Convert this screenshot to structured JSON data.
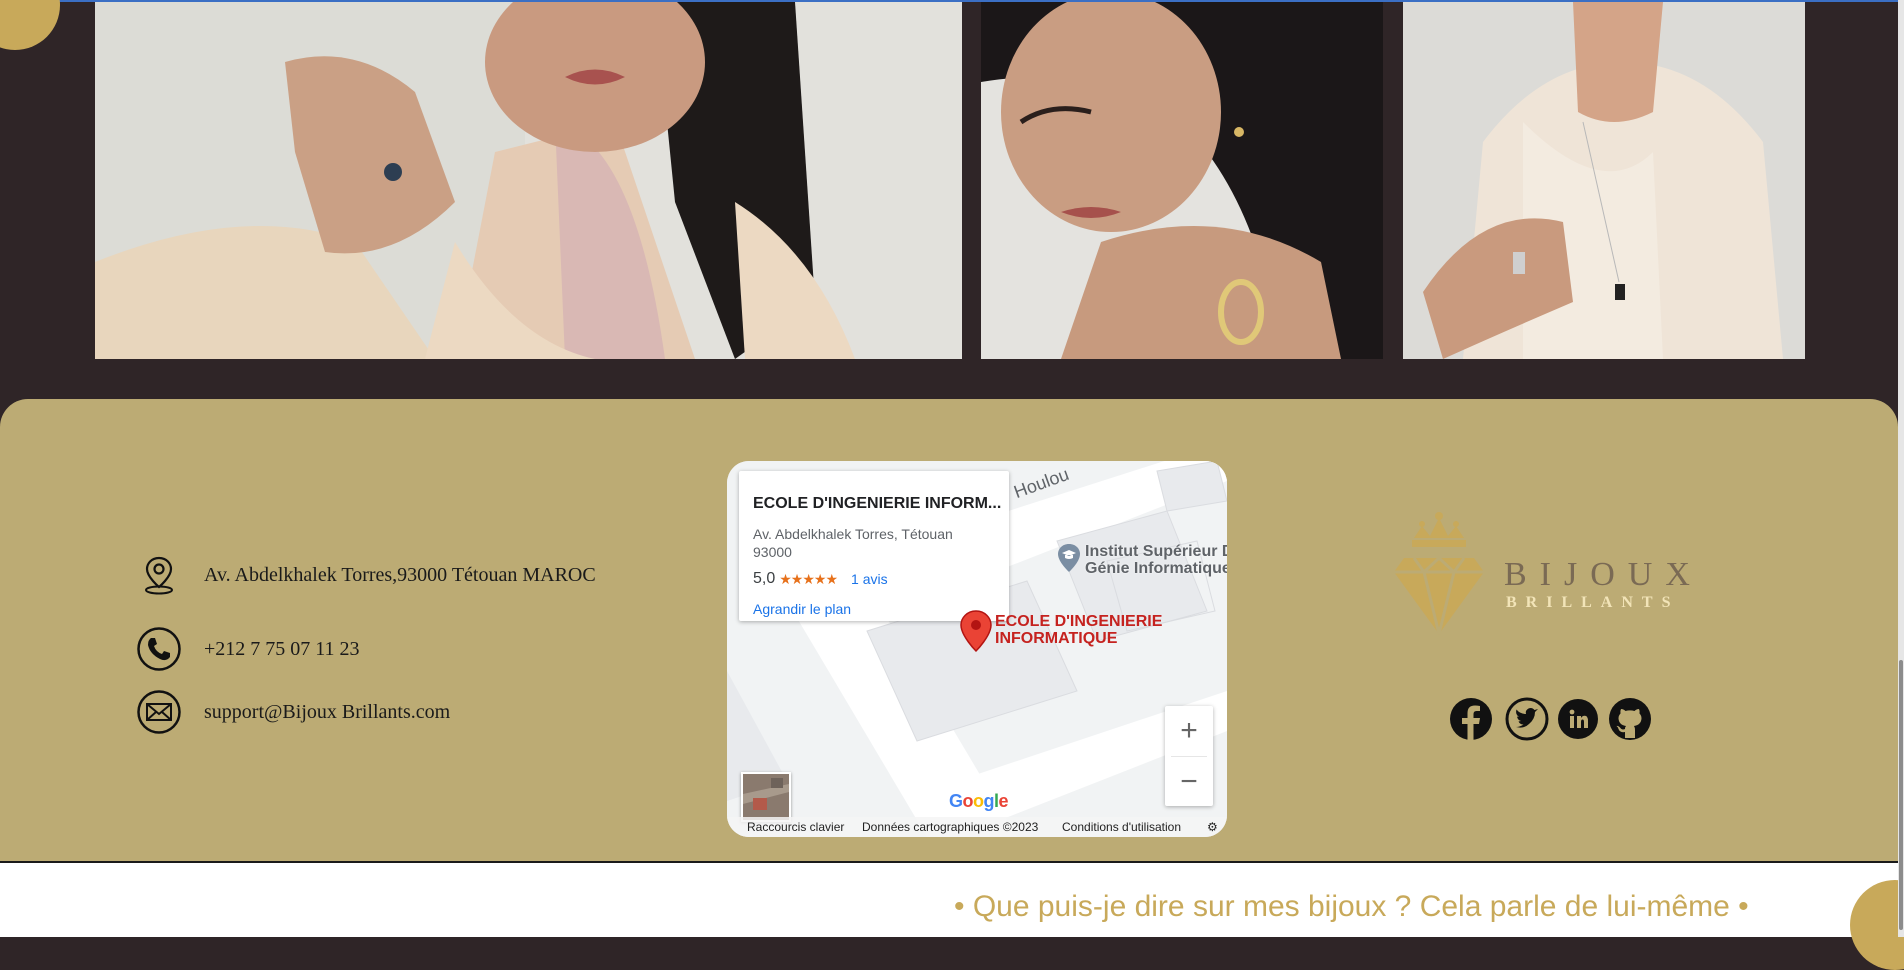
{
  "gallery": {
    "images": [
      {
        "alt": "woman-braids-rings"
      },
      {
        "alt": "woman-ring-earrings"
      },
      {
        "alt": "man-ring-necklace"
      }
    ]
  },
  "contact": {
    "address": "Av. Abdelkhalek Torres,93000 Tétouan MAROC",
    "phone": "+212 7 75 07 11 23",
    "email": "support@Bijoux Brillants.com"
  },
  "map": {
    "place_title": "ECOLE D'INGENIERIE INFORM...",
    "place_address": "Av. Abdelkhalek Torres, Tétouan 93000",
    "rating": "5,0",
    "stars": "★★★★★",
    "reviews": "1 avis",
    "enlarge": "Agrandir le plan",
    "poi_institute": "Institut Supérieur De Génie Informatique",
    "poi_school_line1": "ECOLE D'INGENIERIE",
    "poi_school_line2": "INFORMATIQUE",
    "street": "Houlou",
    "zoom_in": "+",
    "zoom_out": "−",
    "footer": {
      "shortcuts": "Raccourcis clavier",
      "data": "Données cartographiques ©2023",
      "terms": "Conditions d'utilisation"
    }
  },
  "logo": {
    "word1": "BIJOUX",
    "word2": "BRILLANTS",
    "color": "#c8a95a"
  },
  "social": [
    "facebook-icon",
    "twitter-icon",
    "linkedin-icon",
    "github-icon"
  ],
  "tagline": "• Que puis-je dire sur mes bijoux ? Cela parle de lui-même •",
  "colors": {
    "footer_bg": "#bcab74",
    "dark_bg": "#2f2527",
    "gold": "#c8a95a"
  }
}
